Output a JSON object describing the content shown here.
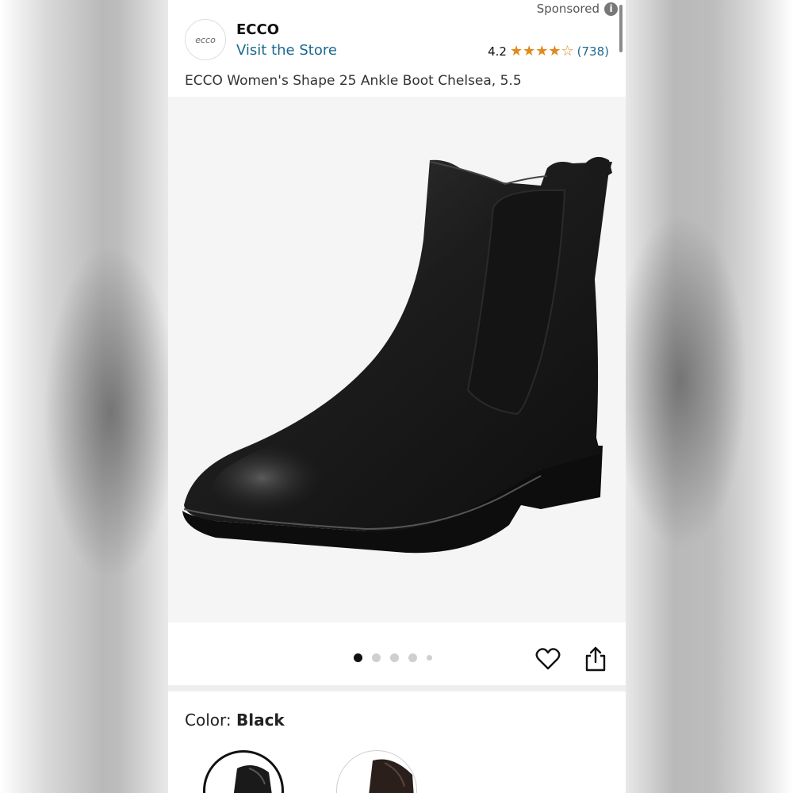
{
  "ad": {
    "label": "Sponsored",
    "info_icon": "info-icon"
  },
  "brand": {
    "logo_text": "ecco",
    "name": "ECCO",
    "visit_store": "Visit the Store"
  },
  "rating": {
    "value": "4.2",
    "stars": 4.2,
    "count": "(738)",
    "star_color": "#e08a1e"
  },
  "product": {
    "title": "ECCO Women's Shape 25 Ankle Boot Chelsea, 5.5"
  },
  "gallery": {
    "image_count": 5,
    "active_index": 0,
    "favorite_icon": "heart-icon",
    "share_icon": "share-icon"
  },
  "color": {
    "label": "Color: ",
    "selected_value": "Black",
    "options": [
      "Black",
      "Brown"
    ]
  },
  "colors": {
    "link": "#1a6a8f",
    "text": "#333333"
  }
}
